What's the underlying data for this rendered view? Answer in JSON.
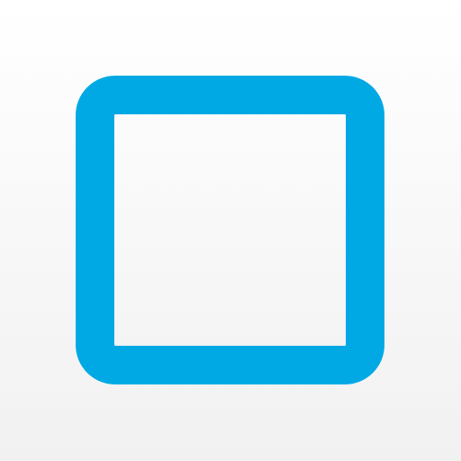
{
  "icon": {
    "name": "square-outline-icon",
    "stroke_color": "#00a9e4",
    "background_top": "#ffffff",
    "background_bottom": "#f1f1f1"
  }
}
